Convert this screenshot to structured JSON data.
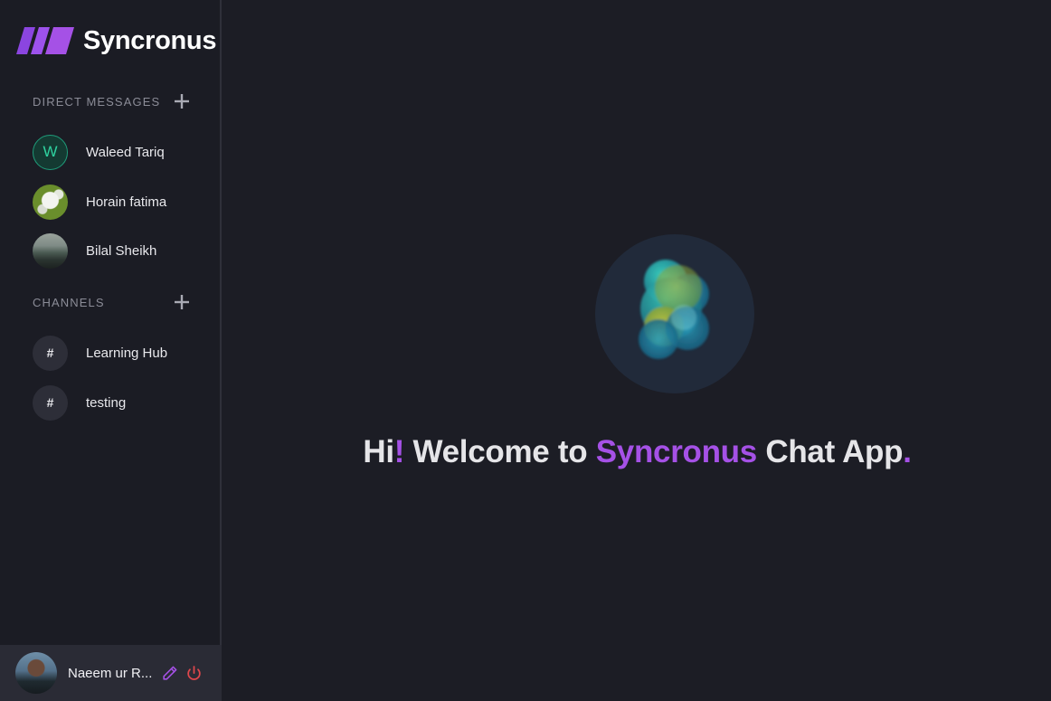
{
  "brand": {
    "name": "Syncronus",
    "logo_icon": "slanted-bars-logo",
    "accent": "#a551e6"
  },
  "direct_messages": {
    "title": "Direct Messages",
    "add_icon": "plus-icon",
    "items": [
      {
        "label": "Waleed Tariq",
        "avatar_letter": "W"
      },
      {
        "label": "Horain fatima"
      },
      {
        "label": "Bilal Sheikh"
      }
    ]
  },
  "channels": {
    "title": "Channels",
    "add_icon": "plus-icon",
    "items": [
      {
        "label": "Learning Hub",
        "symbol": "#"
      },
      {
        "label": "testing",
        "symbol": "#"
      }
    ]
  },
  "profile": {
    "name": "Naeem ur R...",
    "edit_icon": "pencil-icon",
    "logout_icon": "power-icon",
    "edit_color": "#a551e6",
    "logout_color": "#e0474c"
  },
  "welcome": {
    "part1": "Hi",
    "bang": "!",
    "part2": " Welcome to ",
    "app_name": "Syncronus",
    "part3": " Chat App",
    "dot": "."
  }
}
